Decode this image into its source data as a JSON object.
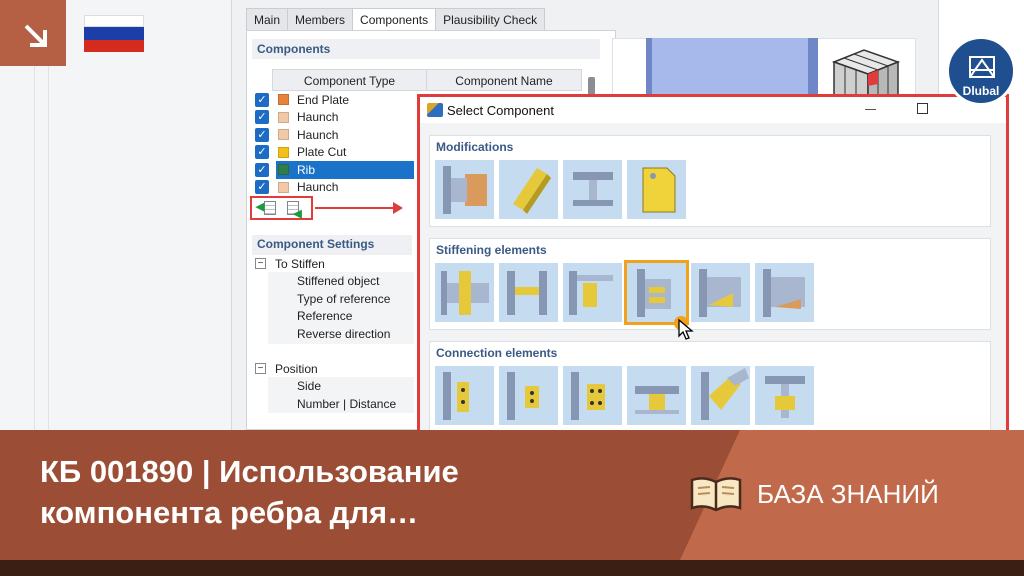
{
  "tabs": [
    "Main",
    "Members",
    "Components",
    "Plausibility Check"
  ],
  "components": {
    "title": "Components",
    "col_type": "Component Type",
    "col_name": "Component Name",
    "rows": [
      {
        "label": "End Plate",
        "color": "#e8823a",
        "checked": true
      },
      {
        "label": "Haunch",
        "color": "#f1c9a6",
        "checked": true
      },
      {
        "label": "Haunch",
        "color": "#f1c9a6",
        "checked": true
      },
      {
        "label": "Plate Cut",
        "color": "#f2c01b",
        "checked": true
      },
      {
        "label": "Rib",
        "color": "#2f7d4a",
        "checked": true,
        "selected": true
      },
      {
        "label": "Haunch",
        "color": "#f1c9a6",
        "checked": true
      }
    ]
  },
  "settings": {
    "title": "Component Settings",
    "group1": "To Stiffen",
    "group1_items": [
      "Stiffened object",
      "Type of reference",
      "Reference",
      "Reverse direction"
    ],
    "group2": "Position",
    "group2_items": [
      "Side",
      "Number | Distance"
    ]
  },
  "dialog": {
    "title": "Select Component",
    "groups": [
      {
        "title": "Modifications",
        "count": 4
      },
      {
        "title": "Stiffening elements",
        "count": 6
      },
      {
        "title": "Connection elements",
        "count": 6
      }
    ]
  },
  "logo": {
    "text": "Dlubal"
  },
  "banner": {
    "title": "КБ 001890 | Использование компонента ребра для…",
    "label": "БАЗА ЗНАНИЙ"
  },
  "colors": {
    "accent_red": "#e23b3b",
    "selection_blue": "#1a73c9",
    "banner": "#9b4e35",
    "highlight_orange": "#f0a21a"
  }
}
